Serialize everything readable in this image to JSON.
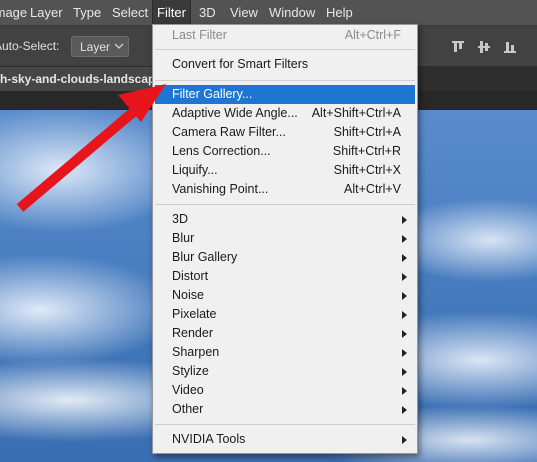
{
  "menubar": {
    "items": [
      {
        "label": "Image"
      },
      {
        "label": "Layer"
      },
      {
        "label": "Type"
      },
      {
        "label": "Select"
      },
      {
        "label": "Filter"
      },
      {
        "label": "3D"
      },
      {
        "label": "View"
      },
      {
        "label": "Window"
      },
      {
        "label": "Help"
      }
    ],
    "active": "Filter"
  },
  "options": {
    "auto_select_label": "Auto-Select:",
    "auto_select_value": "Layer"
  },
  "document_tab": {
    "title": "th-sky-and-clouds-landscap"
  },
  "filter_menu": {
    "items": [
      {
        "label": "Last Filter",
        "shortcut": "Alt+Ctrl+F",
        "state": "disabled"
      },
      {
        "label": "Convert for Smart Filters",
        "shortcut": ""
      },
      {
        "label": "Filter Gallery...",
        "shortcut": "",
        "state": "highlighted"
      },
      {
        "label": "Adaptive Wide Angle...",
        "shortcut": "Alt+Shift+Ctrl+A"
      },
      {
        "label": "Camera Raw Filter...",
        "shortcut": "Shift+Ctrl+A"
      },
      {
        "label": "Lens Correction...",
        "shortcut": "Shift+Ctrl+R"
      },
      {
        "label": "Liquify...",
        "shortcut": "Shift+Ctrl+X"
      },
      {
        "label": "Vanishing Point...",
        "shortcut": "Alt+Ctrl+V"
      },
      {
        "label": "3D",
        "submenu": true
      },
      {
        "label": "Blur",
        "submenu": true
      },
      {
        "label": "Blur Gallery",
        "submenu": true
      },
      {
        "label": "Distort",
        "submenu": true
      },
      {
        "label": "Noise",
        "submenu": true
      },
      {
        "label": "Pixelate",
        "submenu": true
      },
      {
        "label": "Render",
        "submenu": true
      },
      {
        "label": "Sharpen",
        "submenu": true
      },
      {
        "label": "Stylize",
        "submenu": true
      },
      {
        "label": "Video",
        "submenu": true
      },
      {
        "label": "Other",
        "submenu": true
      },
      {
        "label": "NVIDIA Tools",
        "submenu": true
      }
    ]
  },
  "colors": {
    "highlight": "#1c76d2",
    "annotation_arrow": "#e8141b"
  }
}
